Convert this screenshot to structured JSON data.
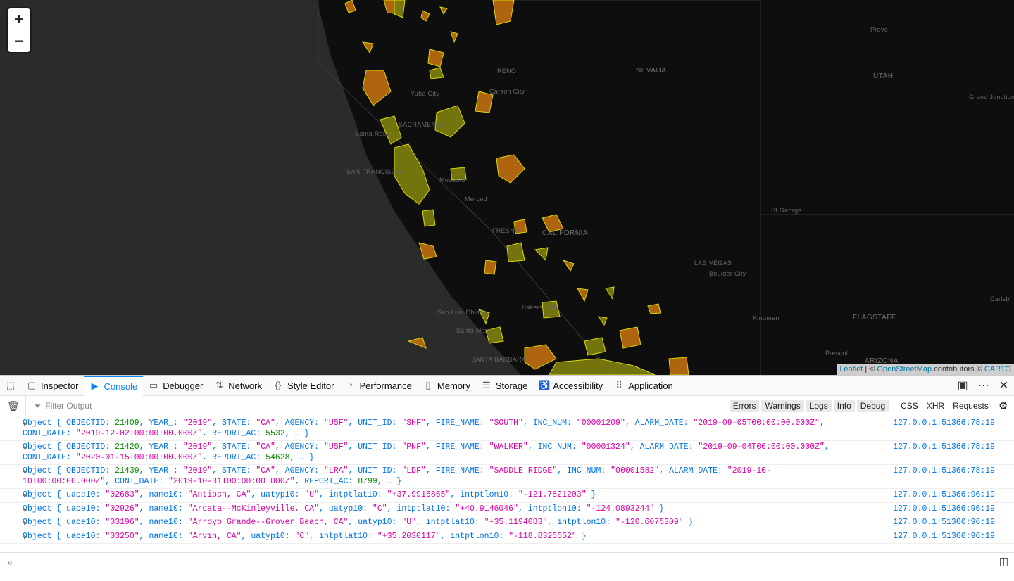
{
  "map": {
    "zoom_in": "+",
    "zoom_out": "−",
    "labels": {
      "nevada": "NEVADA",
      "utah": "UTAH",
      "california": "CALIFORNIA",
      "arizona": "ARIZONA",
      "reno": "RENO",
      "carson": "Carson City",
      "sf": "SAN FRANCISCO",
      "santa_rosa": "Santa Rosa",
      "sacramento": "SACRAMENTO",
      "modesto": "Modesto",
      "merced": "Merced",
      "fresno": "FRESNO",
      "bakersfield": "Bakersfield",
      "san_luis": "San Luis Obispo",
      "santa_maria": "Santa Maria",
      "santa_barbara": "SANTA BARBARA",
      "las_vegas": "LAS VEGAS",
      "boulder": "Boulder City",
      "st_george": "St George",
      "kingman": "Kingman",
      "flagstaff": "FLAGSTAFF",
      "prescott": "Prescott",
      "provo": "Provo",
      "grand_junction": "Grand Junction",
      "yuba": "Yuba City",
      "carlsbad": "Carlsb"
    },
    "attribution": {
      "leaflet": "Leaflet",
      "sep": " | © ",
      "osm": "OpenStreetMap",
      "mid": " contributors © ",
      "carto": "CARTO"
    }
  },
  "devtools": {
    "tabs": [
      {
        "label": "Inspector",
        "icon": "inspector-icon"
      },
      {
        "label": "Console",
        "icon": "console-icon"
      },
      {
        "label": "Debugger",
        "icon": "debugger-icon"
      },
      {
        "label": "Network",
        "icon": "network-icon"
      },
      {
        "label": "Style Editor",
        "icon": "style-editor-icon"
      },
      {
        "label": "Performance",
        "icon": "performance-icon"
      },
      {
        "label": "Memory",
        "icon": "memory-icon"
      },
      {
        "label": "Storage",
        "icon": "storage-icon"
      },
      {
        "label": "Accessibility",
        "icon": "accessibility-icon"
      },
      {
        "label": "Application",
        "icon": "application-icon"
      }
    ],
    "filter_placeholder": "Filter Output",
    "levels": [
      "Errors",
      "Warnings",
      "Logs",
      "Info",
      "Debug"
    ],
    "extra": [
      "CSS",
      "XHR",
      "Requests"
    ],
    "source_a": "127.0.0.1:51366:78:19",
    "source_b": "127.0.0.1:51366:96:19",
    "rows": [
      {
        "kind": "fire",
        "objectid": "21409",
        "year": "\"2019\"",
        "state": "\"CA\"",
        "agency": "\"USF\"",
        "unit": "\"SHF\"",
        "fire": "\"SOUTH\"",
        "inc": "\"00001209\"",
        "alarm": "\"2019-09-05T00:00:00.000Z\"",
        "cont": "\"2019-12-02T00:00:00.000Z\"",
        "report": "5532"
      },
      {
        "kind": "fire",
        "objectid": "21420",
        "year": "\"2019\"",
        "state": "\"CA\"",
        "agency": "\"USF\"",
        "unit": "\"PNF\"",
        "fire": "\"WALKER\"",
        "inc": "\"00001324\"",
        "alarm": "\"2019-09-04T00:00:00.000Z\"",
        "cont": "\"2020-01-15T00:00:00.000Z\"",
        "report": "54628"
      },
      {
        "kind": "fire",
        "objectid": "21439",
        "year": "\"2019\"",
        "state": "\"CA\"",
        "agency": "\"LRA\"",
        "unit": "\"LDF\"",
        "fire": "\"SADDLE RIDGE\"",
        "inc": "\"00001582\"",
        "alarm": "\"2019-10-10T00:00:00.000Z\"",
        "cont": "\"2019-10-31T00:00:00.000Z\"",
        "report": "8799"
      },
      {
        "kind": "urban",
        "uace": "\"02683\"",
        "name": "\"Antioch, CA\"",
        "utype": "\"U\"",
        "lat": "\"+37.9916865\"",
        "lon": "\"-121.7821203\""
      },
      {
        "kind": "urban",
        "uace": "\"02926\"",
        "name": "\"Arcata--McKinleyville, CA\"",
        "utype": "\"C\"",
        "lat": "\"+40.9146046\"",
        "lon": "\"-124.0893244\""
      },
      {
        "kind": "urban",
        "uace": "\"03196\"",
        "name": "\"Arroyo Grande--Grover Beach, CA\"",
        "utype": "\"U\"",
        "lat": "\"+35.1194083\"",
        "lon": "\"-120.6075309\""
      },
      {
        "kind": "urban",
        "uace": "\"03250\"",
        "name": "\"Arvin, CA\"",
        "utype": "\"C\"",
        "lat": "\"+35.2030117\"",
        "lon": "\"-118.8325552\""
      }
    ],
    "prompt": "»"
  }
}
